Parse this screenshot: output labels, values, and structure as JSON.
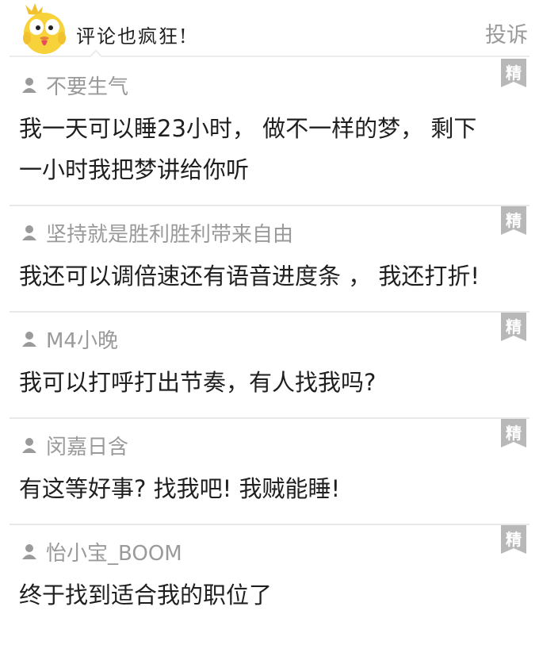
{
  "header": {
    "title": "评论也疯狂!",
    "report_label": "投诉",
    "mascot_icon": "yellow-chick-mascot"
  },
  "colors": {
    "badge": "#b8b8b8",
    "muted": "#9a9a9a",
    "divider": "#e8e8e8"
  },
  "comments": [
    {
      "author": "不要生气",
      "text": "我一天可以睡23小时， 做不一样的梦， 剩下一小时我把梦讲给你听",
      "badge": "精"
    },
    {
      "author": "坚持就是胜利胜利带来自由",
      "text": "我还可以调倍速还有语音进度条 ， 我还打折!",
      "badge": "精"
    },
    {
      "author": "M4小晚",
      "text": "我可以打呼打出节奏，有人找我吗?",
      "badge": "精"
    },
    {
      "author": "闵嘉日含",
      "text": "有这等好事? 找我吧! 我贼能睡!",
      "badge": "精"
    },
    {
      "author": "怡小宝_BOOM",
      "text": "终于找到适合我的职位了",
      "badge": "精"
    }
  ]
}
